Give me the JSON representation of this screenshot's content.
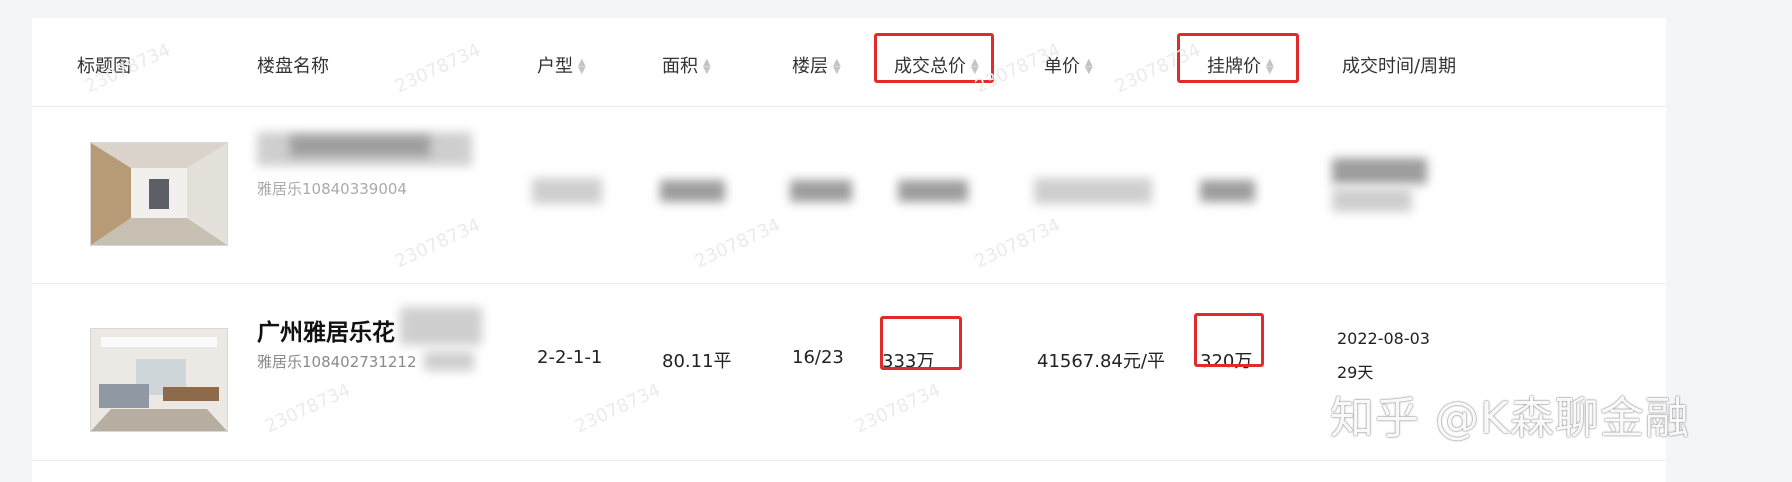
{
  "table": {
    "columns": [
      {
        "label": "标题图",
        "sortable": false
      },
      {
        "label": "楼盘名称",
        "sortable": false
      },
      {
        "label": "户型",
        "sortable": true
      },
      {
        "label": "面积",
        "sortable": true
      },
      {
        "label": "楼层",
        "sortable": true
      },
      {
        "label": "成交总价",
        "sortable": true
      },
      {
        "label": "单价",
        "sortable": true
      },
      {
        "label": "挂牌价",
        "sortable": true
      },
      {
        "label": "成交时间/周期",
        "sortable": false
      }
    ],
    "rows": [
      {
        "name": "",
        "code": "雅居乐10840339004",
        "layout": "",
        "area": "",
        "floor": "",
        "total_price": "",
        "unit_price": "",
        "list_price": "",
        "deal_time": "",
        "cycle": ""
      },
      {
        "name": "广州雅居乐花",
        "code": "雅居乐108402731212",
        "layout": "2-2-1-1",
        "area": "80.11平",
        "floor": "16/23",
        "total_price": "333万",
        "unit_price": "41567.84元/平",
        "list_price": "320万",
        "deal_time": "2022-08-03",
        "cycle": "29天"
      }
    ]
  },
  "watermark": {
    "text": "23078734",
    "brand": "知乎 @K森聊金融"
  },
  "colors": {
    "highlight": "#e12b2b",
    "background": "#f4f5f7",
    "panel": "#ffffff"
  }
}
